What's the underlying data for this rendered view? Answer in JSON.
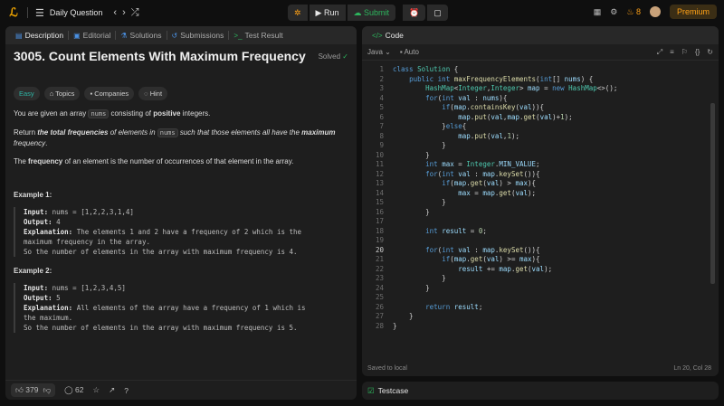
{
  "topbar": {
    "nav_title": "Daily Question",
    "run_label": "Run",
    "submit_label": "Submit",
    "streak_count": "8",
    "premium_label": "Premium"
  },
  "left_tabs": [
    "Description",
    "Editorial",
    "Solutions",
    "Submissions",
    "Test Result"
  ],
  "problem": {
    "title": "3005. Count Elements With Maximum Frequency",
    "solved_label": "Solved",
    "chips": [
      "Easy",
      "Topics",
      "Companies",
      "Hint"
    ],
    "p1_a": "You are given an array ",
    "p1_code": "nums",
    "p1_b": " consisting of ",
    "p1_bold": "positive",
    "p1_c": " integers.",
    "p2_a": "Return ",
    "p2_bi": "the total frequencies",
    "p2_b": " of elements in ",
    "p2_code": "nums",
    "p2_c": " such that those elements all have the ",
    "p2_bi2": "maximum",
    "p2_d": " frequency",
    "p2_e": ".",
    "p3_a": "The ",
    "p3_bold": "frequency",
    "p3_b": " of an element is the number of occurrences of that element in the array.",
    "ex1_title": "Example 1:",
    "ex1_input_label": "Input:",
    "ex1_input": " nums = [1,2,2,3,1,4]",
    "ex1_output_label": "Output:",
    "ex1_output": " 4",
    "ex1_expl_label": "Explanation:",
    "ex1_expl1": " The elements 1 and 2 have a frequency of 2 which is the",
    "ex1_expl2": "maximum frequency in the array.",
    "ex1_expl3": "So the number of elements in the array with maximum frequency is 4.",
    "ex2_title": "Example 2:",
    "ex2_input_label": "Input:",
    "ex2_input": " nums = [1,2,3,4,5]",
    "ex2_output_label": "Output:",
    "ex2_output": " 5",
    "ex2_expl_label": "Explanation:",
    "ex2_expl1": " All elements of the array have a frequency of 1 which is",
    "ex2_expl2": "the maximum.",
    "ex2_expl3": "So the number of elements in the array with maximum frequency is 5."
  },
  "footer": {
    "likes": "379",
    "comments": "62"
  },
  "editor": {
    "panel_title": "Code",
    "language": "Java",
    "mode": "Auto",
    "saved": "Saved to local",
    "cursor": "Ln 20, Col 28",
    "current_line": 20,
    "lines": [
      "class Solution {",
      "    public int maxFrequencyElements(int[] nums) {",
      "        HashMap<Integer,Integer> map = new HashMap<>();",
      "        for(int val : nums){",
      "            if(map.containsKey(val)){",
      "                map.put(val,map.get(val)+1);",
      "            }else{",
      "                map.put(val,1);",
      "            }",
      "        }",
      "        int max = Integer.MIN_VALUE;",
      "        for(int val : map.keySet()){",
      "            if(map.get(val) > max){",
      "                max = map.get(val);",
      "            }",
      "        }",
      "",
      "        int result = 0;",
      "",
      "        for(int val : map.keySet()){",
      "            if(map.get(val) >= max){",
      "                result += map.get(val);",
      "            }",
      "        }",
      "",
      "        return result;",
      "    }",
      "}"
    ]
  },
  "bottom": {
    "testcase_label": "Testcase"
  }
}
